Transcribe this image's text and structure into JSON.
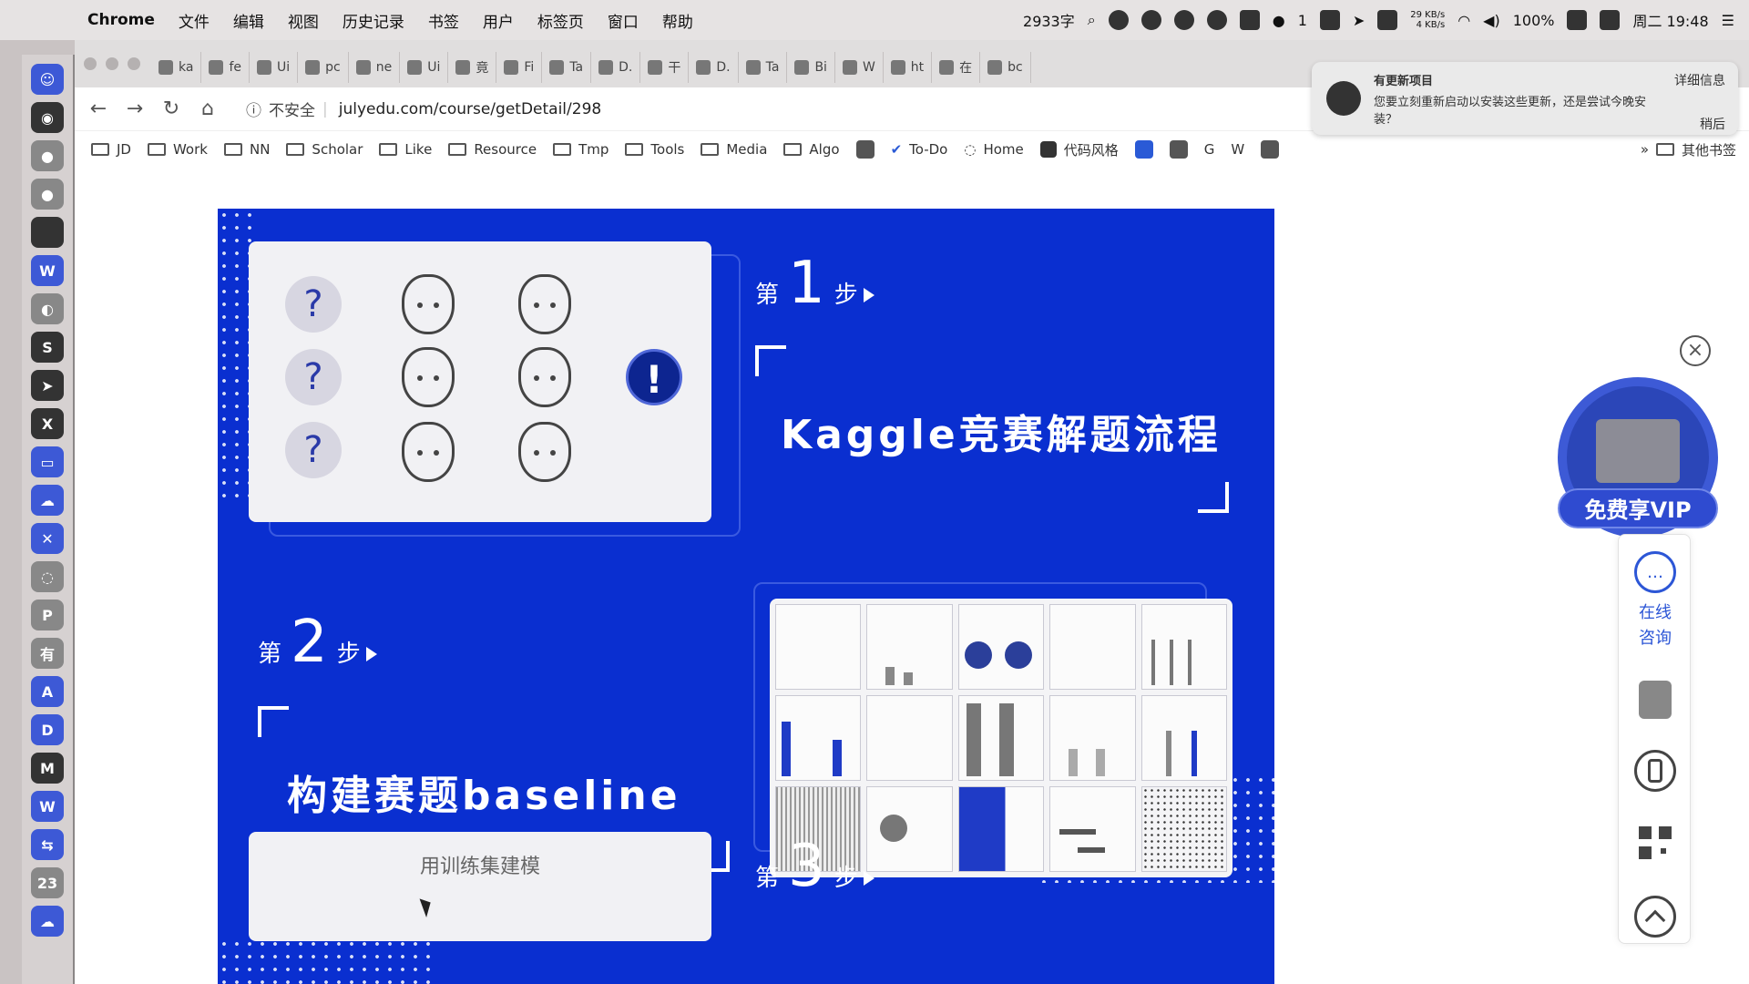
{
  "menubar": {
    "app": "Chrome",
    "items": [
      "文件",
      "编辑",
      "视图",
      "历史记录",
      "书签",
      "用户",
      "标签页",
      "窗口",
      "帮助"
    ],
    "word_count": "2933字",
    "wechat_count": "1",
    "net_up": "29 KB/s",
    "net_down": "4 KB/s",
    "battery": "100%",
    "clock": "周二 19:48"
  },
  "tabs": [
    "ka",
    "fe",
    "Ui",
    "pc",
    "ne",
    "Ui",
    "竟",
    "Fi",
    "Ta",
    "D.",
    "干",
    "D.",
    "Ta",
    "Bi",
    "W",
    "ht",
    "在",
    "bc"
  ],
  "toolbar": {
    "security": "不安全",
    "url": "julyedu.com/course/getDetail/298"
  },
  "bookmarks": [
    "JD",
    "Work",
    "NN",
    "Scholar",
    "Like",
    "Resource",
    "Tmp",
    "Tools",
    "Media",
    "Algo",
    "To-Do",
    "Home",
    "代码风格"
  ],
  "bookmarks_more": "»",
  "bookmarks_other": "其他书签",
  "notification": {
    "title": "有更新项目",
    "body": "您要立刻重新启动以安装这些更新，还是尝试今晚安装？",
    "action_primary": "详细信息",
    "action_secondary": "稍后"
  },
  "poster": {
    "step_prefix": "第",
    "step_suffix": "步",
    "step1": {
      "num": "1",
      "title": "Kaggle竞赛解题流程"
    },
    "step2": {
      "num": "2",
      "title": "构建赛题baseline"
    },
    "step3": {
      "num": "3",
      "card_text": "用训练集建模"
    },
    "qmark": "?",
    "excl": "!"
  },
  "float": {
    "close": "×",
    "vip": "免费享VIP",
    "consult": "在线咨询"
  },
  "colors": {
    "poster_bg": "#0a2fd0",
    "accent": "#2c56d6"
  }
}
